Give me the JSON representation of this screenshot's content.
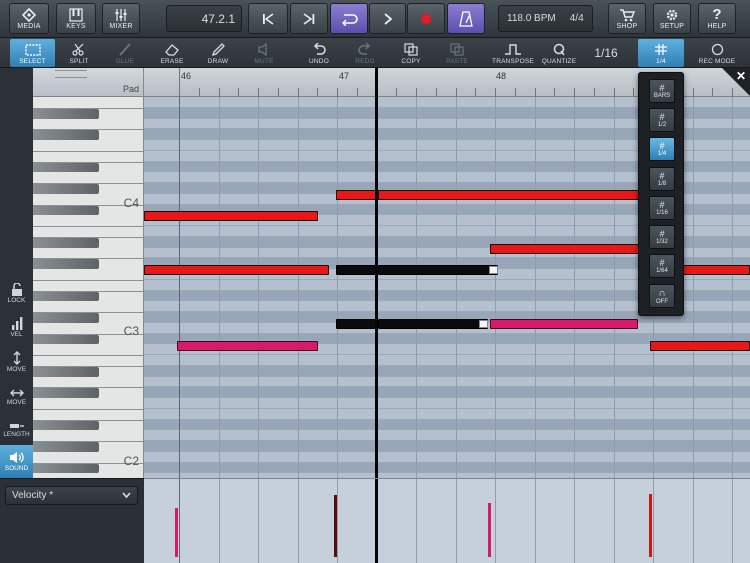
{
  "top": {
    "media": "MEDIA",
    "keys": "KEYS",
    "mixer": "MIXER",
    "position": "47.2.1",
    "tempo": "118.0 BPM",
    "signature": "4/4",
    "shop": "SHOP",
    "setup": "SETUP",
    "help": "HELP"
  },
  "tools": {
    "select": "SELECT",
    "split": "SPLIT",
    "glue": "GLUE",
    "erase": "ERASE",
    "draw": "DRAW",
    "mute": "MUTE",
    "undo": "UNDO",
    "redo": "REDO",
    "copy": "COPY",
    "paste": "PASTE",
    "transpose": "TRANSPOSE",
    "quantize": "QUANTIZE",
    "quantize_value": "1/16",
    "grid": "1/4",
    "rec_mode": "REC MODE"
  },
  "side": {
    "lock": "LOCK",
    "vel": "VEL",
    "move": "MOVE",
    "move2": "MOVE",
    "length": "LENGTH",
    "sound": "SOUND"
  },
  "keyboard": {
    "pad": "Pad",
    "c4": "C4",
    "c3": "C3",
    "c2": "C2"
  },
  "ruler": {
    "bar46": "46",
    "bar47": "47",
    "bar48": "48"
  },
  "velocity": {
    "selector": "Velocity *"
  },
  "quantize_menu": {
    "options": [
      "BARS",
      "1/2",
      "1/4",
      "1/8",
      "1/16",
      "1/32",
      "1/64",
      "OFF"
    ],
    "selected": "1/4"
  },
  "colors": {
    "note_red": "#e81818",
    "note_pink": "#d81a6a",
    "note_black": "#0b0b0b",
    "accent": "#3a8fca"
  }
}
